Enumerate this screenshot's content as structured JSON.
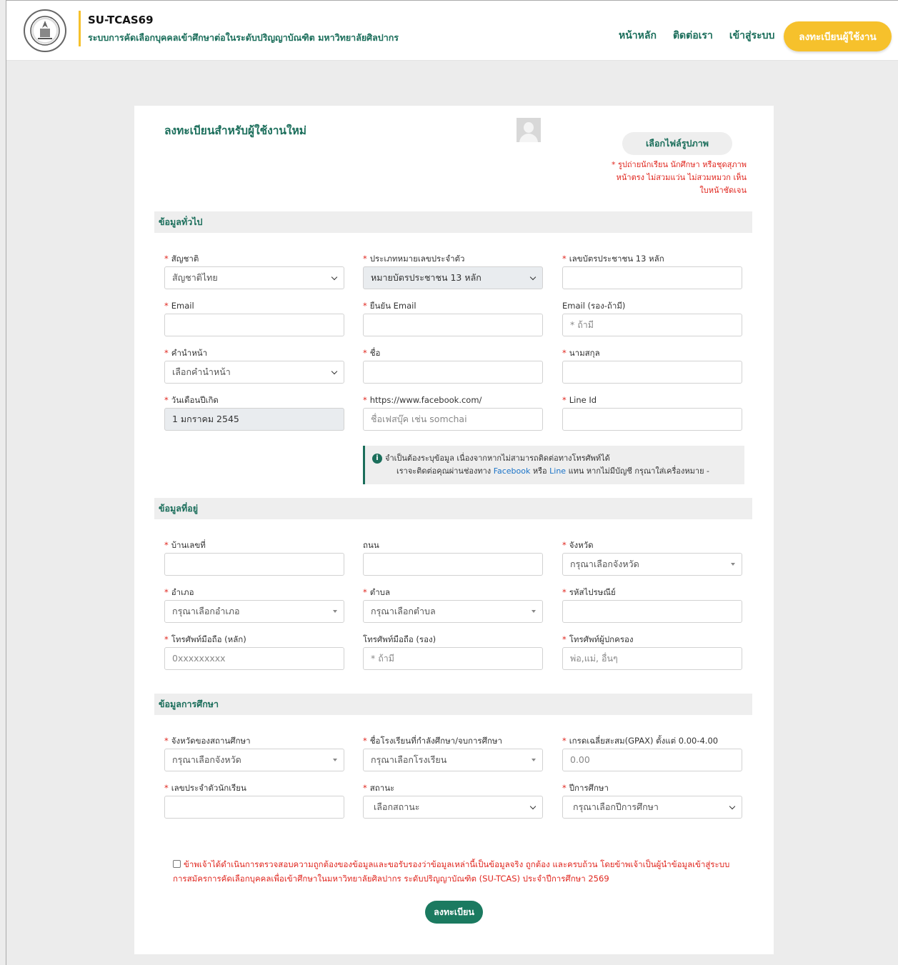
{
  "header": {
    "site_title": "SU-TCAS69",
    "site_subtitle": "ระบบการคัดเลือกบุคคลเข้าศึกษาต่อในระดับปริญญาบัณฑิต มหาวิทยาลัยศิลปากร",
    "nav": [
      "หน้าหลัก",
      "ติดต่อเรา",
      "เข้าสู่ระบบ"
    ],
    "register_button": "ลงทะเบียนผู้ใช้งาน",
    "accent_color": "#f6c12c",
    "brand_color": "#1b6e5b"
  },
  "form": {
    "title": "ลงทะเบียนสำหรับผู้ใช้งานใหม่",
    "photo_button": "เลือกไฟล์รูปภาพ",
    "photo_note": "* รูปถ่ายนักเรียน นักศึกษา หรือชุดสุภาพ หน้าตรง ไม่สวมแว่น ไม่สวมหมวก เห็นใบหน้าชัดเจน",
    "sections": {
      "general": "ข้อมูลทั่วไป",
      "address": "ข้อมูลที่อยู่",
      "education": "ข้อมูลการศึกษา"
    },
    "fields": {
      "nationality": {
        "label": "สัญชาติ",
        "value": "สัญชาติไทย"
      },
      "id_type": {
        "label": "ประเภทหมายเลขประจำตัว",
        "value": "หมายบัตรประชาชน 13 หลัก"
      },
      "id_number": {
        "label": "เลขบัตรประชาชน 13 หลัก",
        "value": ""
      },
      "email": {
        "label": "Email",
        "value": ""
      },
      "email_confirm": {
        "label": "ยืนยัน Email",
        "value": ""
      },
      "email_alt": {
        "label": "Email (รอง-ถ้ามี)",
        "placeholder": "* ถ้ามี"
      },
      "prefix": {
        "label": "คำนำหน้า",
        "value": "เลือกคำนำหน้า"
      },
      "first_name": {
        "label": "ชื่อ",
        "value": ""
      },
      "last_name": {
        "label": "นามสกุล",
        "value": ""
      },
      "birthdate": {
        "label": "วันเดือนปีเกิด",
        "value": "1 มกราคม 2545"
      },
      "facebook": {
        "label": "https://www.facebook.com/",
        "placeholder": "ชื่อเฟสบุ๊ค เช่น somchai"
      },
      "line_id": {
        "label": "Line Id",
        "value": ""
      },
      "house_no": {
        "label": "บ้านเลขที่",
        "value": ""
      },
      "road": {
        "label": "ถนน",
        "value": ""
      },
      "province": {
        "label": "จังหวัด",
        "value": "กรุณาเลือกจังหวัด"
      },
      "district": {
        "label": "อำเภอ",
        "value": "กรุณาเลือกอำเภอ"
      },
      "subdistrict": {
        "label": "ตำบล",
        "value": "กรุณาเลือกตำบล"
      },
      "postcode": {
        "label": "รหัสไปรษณีย์",
        "value": ""
      },
      "mobile": {
        "label": "โทรศัพท์มือถือ (หลัก)",
        "placeholder": "0xxxxxxxxx"
      },
      "mobile_alt": {
        "label": "โทรศัพท์มือถือ (รอง)",
        "placeholder": "* ถ้ามี"
      },
      "guardian_phone": {
        "label": "โทรศัพท์ผู้ปกครอง",
        "placeholder": "พ่อ,แม่, อื่นๆ"
      },
      "school_province": {
        "label": "จังหวัดของสถานศึกษา",
        "value": "กรุณาเลือกจังหวัด"
      },
      "school_name": {
        "label": "ชื่อโรงเรียนที่กำลังศึกษา/จบการศึกษา",
        "value": "กรุณาเลือกโรงเรียน"
      },
      "gpax": {
        "label": "เกรดเฉลี่ยสะสม(GPAX) ตั้งแต่ 0.00-4.00",
        "placeholder": "0.00"
      },
      "student_id": {
        "label": "เลขประจำตัวนักเรียน",
        "value": ""
      },
      "status": {
        "label": "สถานะ",
        "value": "เลือกสถานะ"
      },
      "academic_year": {
        "label": "ปีการศึกษา",
        "value": "กรุณาเลือกปีการศึกษา"
      }
    },
    "info": {
      "line1": "จำเป็นต้องระบุข้อมูล เนื่องจากหากไม่สามารถติดต่อทางโทรศัพท์ได้",
      "line2_a": "เราจะติดต่อคุณผ่านช่องทาง ",
      "facebook": "Facebook",
      "or": " หรือ ",
      "line": "Line",
      "line2_b": " แทน หากไม่มีบัญชี กรุณาใส่เครื่องหมาย -"
    },
    "consent": "ข้าพเจ้าได้ดำเนินการตรวจสอบความถูกต้องของข้อมูลและขอรับรองว่าข้อมูลเหล่านี้เป็นข้อมูลจริง ถูกต้อง และครบถ้วน โดยข้าพเจ้าเป็นผู้นำข้อมูลเข้าสู่ระบบการสมัครการคัดเลือกบุคคลเพื่อเข้าศึกษาในมหาวิทยาลัยศิลปากร ระดับปริญญาบัณฑิต (SU-TCAS) ประจำปีการศึกษา 2569",
    "submit": "ลงทะเบียน"
  }
}
